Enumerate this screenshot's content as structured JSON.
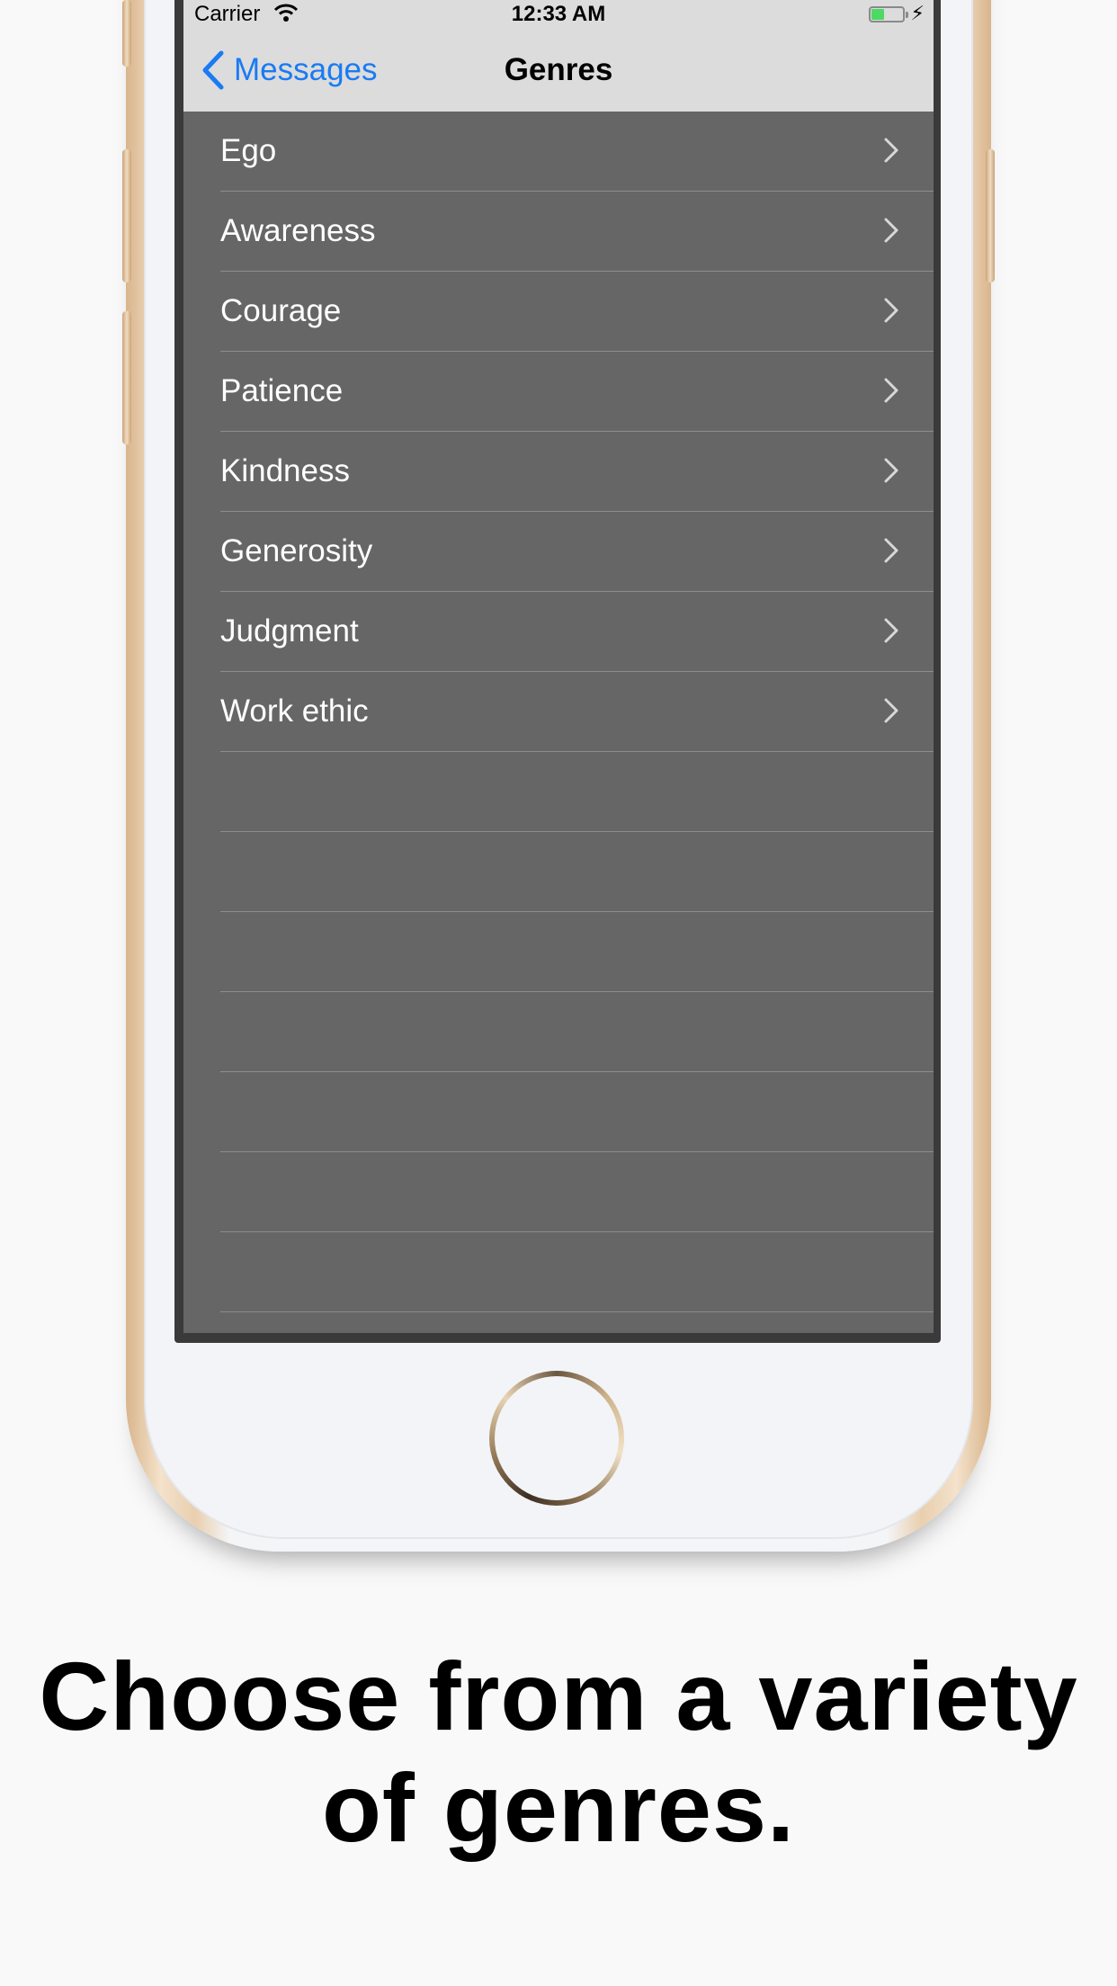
{
  "status_bar": {
    "carrier": "Carrier",
    "time": "12:33 AM",
    "battery_color": "#4cd964"
  },
  "nav": {
    "back_label": "Messages",
    "title": "Genres",
    "accent": "#1a7bf2"
  },
  "genres": [
    "Ego",
    "Awareness",
    "Courage",
    "Patience",
    "Kindness",
    "Generosity",
    "Judgment",
    "Work ethic"
  ],
  "caption": {
    "line1": "Choose from a variety",
    "line2": "of genres."
  },
  "icons": [
    "wifi-icon",
    "battery-icon",
    "charging-bolt-icon",
    "chevron-left-icon",
    "chevron-right-icon",
    "home-button"
  ]
}
